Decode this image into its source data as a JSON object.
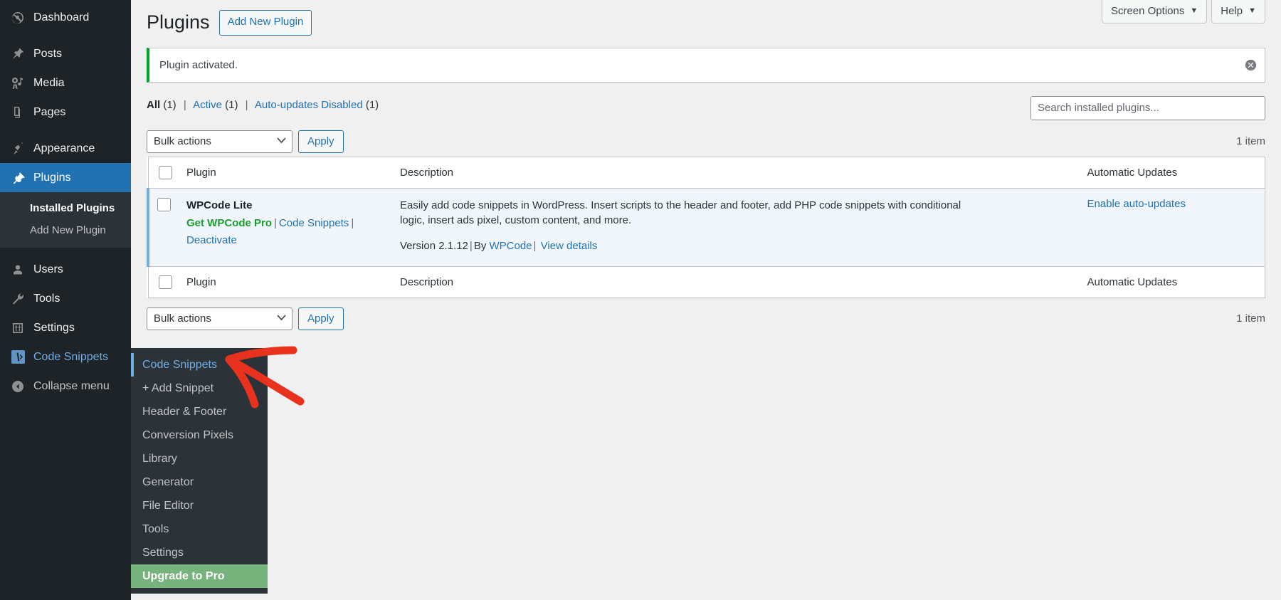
{
  "sidebar": {
    "items": [
      {
        "label": "Dashboard",
        "icon": "dashboard-icon"
      },
      {
        "label": "Posts",
        "icon": "pin-icon"
      },
      {
        "label": "Media",
        "icon": "media-icon"
      },
      {
        "label": "Pages",
        "icon": "pages-icon"
      },
      {
        "label": "Appearance",
        "icon": "appearance-brush-icon"
      },
      {
        "label": "Plugins",
        "icon": "plugins-plug-icon"
      },
      {
        "label": "Users",
        "icon": "users-icon"
      },
      {
        "label": "Tools",
        "icon": "tools-wrench-icon"
      },
      {
        "label": "Settings",
        "icon": "settings-sliders-icon"
      },
      {
        "label": "Code Snippets",
        "icon": "code-snippets-icon"
      },
      {
        "label": "Collapse menu",
        "icon": "collapse-arrow-icon"
      }
    ],
    "plugins_submenu": [
      {
        "label": "Installed Plugins",
        "current": true
      },
      {
        "label": "Add New Plugin",
        "current": false
      }
    ],
    "active_item": "Plugins",
    "hovered_item": "Code Snippets"
  },
  "flyout": {
    "items": [
      {
        "label": "Code Snippets",
        "state": "current"
      },
      {
        "label": "+ Add Snippet",
        "state": "normal"
      },
      {
        "label": "Header & Footer",
        "state": "normal"
      },
      {
        "label": "Conversion Pixels",
        "state": "normal"
      },
      {
        "label": "Library",
        "state": "normal"
      },
      {
        "label": "Generator",
        "state": "normal"
      },
      {
        "label": "File Editor",
        "state": "normal"
      },
      {
        "label": "Tools",
        "state": "normal"
      },
      {
        "label": "Settings",
        "state": "normal"
      },
      {
        "label": "Upgrade to Pro",
        "state": "upgrade"
      }
    ]
  },
  "screen_meta": {
    "screen_options": "Screen Options",
    "help": "Help",
    "caret": "▼"
  },
  "header": {
    "title": "Plugins",
    "add_new_button": "Add New Plugin"
  },
  "notice": {
    "text": "Plugin activated.",
    "dismiss_icon": "dismiss-circle-x-icon",
    "accent_color": "#00a32a"
  },
  "filters": {
    "all_label": "All",
    "all_count": "(1)",
    "active_label": "Active",
    "active_count": "(1)",
    "autoupdates_label": "Auto-updates Disabled",
    "autoupdates_count": "(1)",
    "divider": "|"
  },
  "search": {
    "placeholder": "Search installed plugins...",
    "value": ""
  },
  "tablenav_top": {
    "bulk_actions_label": "Bulk actions",
    "apply_label": "Apply",
    "displaying_num": "1 item"
  },
  "tablenav_bottom": {
    "bulk_actions_label": "Bulk actions",
    "apply_label": "Apply",
    "displaying_num": "1 item"
  },
  "table": {
    "columns": {
      "plugin": "Plugin",
      "description": "Description",
      "automatic_updates": "Automatic Updates"
    },
    "rows": [
      {
        "name": "WPCode Lite",
        "actions": {
          "pro": "Get WPCode Pro",
          "snippets": "Code Snippets",
          "deactivate": "Deactivate",
          "separator": "|"
        },
        "description": "Easily add code snippets in WordPress. Insert scripts to the header and footer, add PHP code snippets with conditional logic, insert ads pixel, custom content, and more.",
        "version_prefix": "Version 2.1.12",
        "by_label": "By",
        "author": "WPCode",
        "view_details": "View details",
        "auto_update": "Enable auto-updates",
        "separator": "|"
      }
    ]
  },
  "colors": {
    "admin_blue": "#2271b1",
    "sidebar_bg": "#1d2327",
    "submenu_bg": "#2c3338",
    "highlight_row": "#f0f6fc",
    "upgrade_green": "#77b37c",
    "pro_green": "#1a9c2f",
    "annotation_red": "#e8321e",
    "page_bg": "#f0f0f1"
  }
}
